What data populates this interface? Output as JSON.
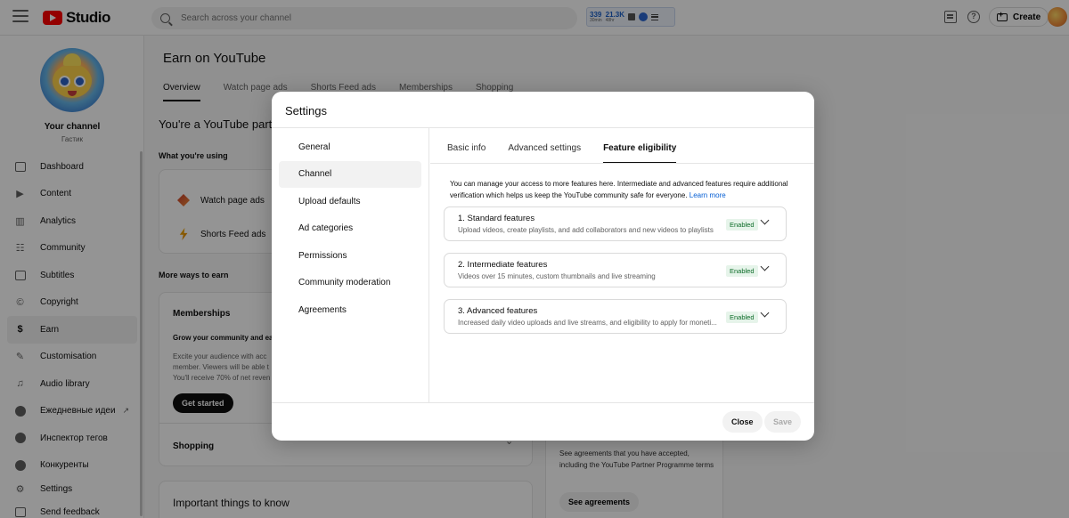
{
  "topbar": {
    "brand": "Studio",
    "search_placeholder": "Search across your channel",
    "extension": {
      "stat1_value": "339",
      "stat1_label": "30min",
      "stat2_value": "21.3K",
      "stat2_label": "48hr"
    },
    "create_label": "Create"
  },
  "sidebar": {
    "channel_name": "Your channel",
    "channel_handle": "Гастик",
    "items": [
      {
        "label": "Dashboard",
        "icon": "dashboard-icon"
      },
      {
        "label": "Content",
        "icon": "content-icon"
      },
      {
        "label": "Analytics",
        "icon": "analytics-icon"
      },
      {
        "label": "Community",
        "icon": "community-icon"
      },
      {
        "label": "Subtitles",
        "icon": "subtitles-icon"
      },
      {
        "label": "Copyright",
        "icon": "copyright-icon"
      },
      {
        "label": "Earn",
        "icon": "earn-icon",
        "active": true
      },
      {
        "label": "Customisation",
        "icon": "customisation-icon"
      },
      {
        "label": "Audio library",
        "icon": "audio-library-icon"
      },
      {
        "label": "Ежедневные идеи",
        "icon": "daily-ideas-icon"
      },
      {
        "label": "Инспектор тегов",
        "icon": "tag-inspector-icon"
      },
      {
        "label": "Конкуренты",
        "icon": "competitors-icon"
      },
      {
        "label": "Settings",
        "icon": "settings-icon"
      },
      {
        "label": "Send feedback",
        "icon": "feedback-icon"
      }
    ]
  },
  "main": {
    "title": "Earn on YouTube",
    "tabs": [
      "Overview",
      "Watch page ads",
      "Shorts Feed ads",
      "Memberships",
      "Shopping"
    ],
    "active_tab": 0,
    "partner_heading": "You're a YouTube partn",
    "using_label": "What you're using",
    "using_items": [
      "Watch page ads",
      "Shorts Feed ads"
    ],
    "more_label": "More ways to earn",
    "memberships": {
      "title": "Memberships",
      "subtitle": "Grow your community and ear",
      "description": "Excite your audience with acc member. Viewers will be able t You'll receive 70% of net reven",
      "button": "Get started"
    },
    "shopping_label": "Shopping",
    "important_title": "Important things to know",
    "agreements_text": "See agreements that you have accepted, including the YouTube Partner Programme terms",
    "agreements_button": "See agreements"
  },
  "modal": {
    "title": "Settings",
    "nav": [
      "General",
      "Channel",
      "Upload defaults",
      "Ad categories",
      "Permissions",
      "Community moderation",
      "Agreements"
    ],
    "active_nav": 1,
    "tabs": [
      "Basic info",
      "Advanced settings",
      "Feature eligibility"
    ],
    "active_tab": 2,
    "intro": "You can manage your access to more features here. Intermediate and advanced features require additional verification which helps us keep the YouTube community safe for everyone.",
    "learn_more": "Learn more",
    "features": [
      {
        "title": "1. Standard features",
        "description": "Upload videos, create playlists, and add collaborators and new videos to playlists",
        "status": "Enabled"
      },
      {
        "title": "2. Intermediate features",
        "description": "Videos over 15 minutes, custom thumbnails and live streaming",
        "status": "Enabled"
      },
      {
        "title": "3. Advanced features",
        "description": "Increased daily video uploads and live streams, and eligibility to apply for moneti...",
        "status": "Enabled"
      }
    ],
    "close_label": "Close",
    "save_label": "Save"
  },
  "colors": {
    "brand": "#ff0000",
    "link": "#065fd4",
    "enabled_bg": "#e6f4ea",
    "enabled_text": "#0b6b27"
  }
}
